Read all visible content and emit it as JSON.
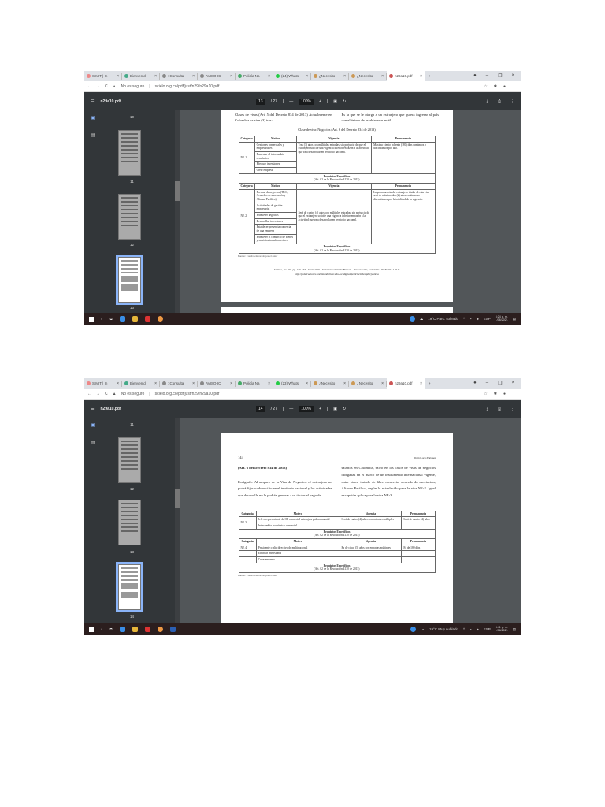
{
  "shot1": {
    "tabs": [
      "SIMIT | In",
      "Bienvenid",
      "::Consulta",
      "AVISO-IC",
      "Policía Na",
      "(24) Whats",
      "¿Necesito",
      "¿Necesito",
      "n29a10.pdf"
    ],
    "url": "scielo.org.co/pdf/just/n29/n29a10.pdf",
    "security": "No es seguro",
    "file": "n29a10.pdf",
    "page": "13",
    "total": "/ 27",
    "zoom": "100%",
    "thumbs": [
      "10",
      "11",
      "12",
      "13"
    ],
    "text_left": "Clases de visas (Art. 5 del Decreto 834 de 2013) Actualmente en Colombia existen (3) tres:",
    "text_right": "Es la que se le otorga a un extranjero que quiera ingresar al país con el ánimo de establecerse en él.",
    "table_title": "Clase de visa: Negocios (Art. 6 del Decreto 834 de 2013)",
    "headers": [
      "Categoría",
      "Motivo",
      "Vigencia",
      "Permanencia"
    ],
    "ne1": {
      "cat": "NE 1",
      "motivos": [
        "Gestiones comerciales y empresariales",
        "Fomentar el intercambio económico",
        "Efectuar inversiones",
        "Crear empresa"
      ],
      "vig": "Tres (3) años con múltiples entradas, sin perjuicio de que el extranjero solicite una vigencia inferior en razón a la actividad que va a desarrollar en territorio nacional.",
      "perm": "Máximo ciento ochenta (180) días continuos o discontinuos por año."
    },
    "req": "Requisitos Específicos",
    "req_ref": "(Art. 02 de la Resolución 4130 de 2015)",
    "ne2": {
      "cat": "NE 2",
      "motivos": [
        "Persona de negocios (TLC, Acuerdos de asociación y Alianza Pacífico)",
        "Actividades de gestión empresarial",
        "Promover negocios",
        "Desarrollar inversiones",
        "Establecer presencia comercial de una empresa",
        "Promover el comercio de bienes y servicios transfronterizos"
      ],
      "vig": "Será de cuatro (4) años con múltiples entradas, sin perjuicio de que el extranjero solicite una vigencia inferior en razón a la actividad que va a desarrollar en territorio nacional.",
      "perm": "La permanencia del extranjero titular de esta visa será de máximo dos (2) años continuos o discontinuos por la totalidad de la vigencia."
    },
    "source": "Fuente: Cuadro elaborado por el autor",
    "footer1": "Justicia, No. 29 - pp. 133-157 - Junio 2016 - Universidad Simón Bolívar - Barranquilla, Colombia - ISSN: 0124-7441",
    "footer2": "http://publicaciones.unisimonbolivar.edu.co/rdigital/justicia/index.php/justicia",
    "weather": "19°C Parc. soleado",
    "lang": "ESP",
    "time": "3:24 p. m.",
    "date": "1/06/2021"
  },
  "shot2": {
    "tabs": [
      "SIMIT | In",
      "Bienvenid",
      "::Consulta",
      "AVISO-IC",
      "Policía Na",
      "(23) Whats",
      "¿Necesito",
      "¿Necesito",
      "n29a10.pdf"
    ],
    "url": "scielo.org.co/pdf/just/n29/n29a10.pdf",
    "security": "No es seguro",
    "file": "n29a10.pdf",
    "page": "14",
    "total": "/ 27",
    "zoom": "100%",
    "thumbs": [
      "11",
      "12",
      "13",
      "14"
    ],
    "page_num": "144",
    "running_head": "David Lucas Enríquez",
    "text_left_head": "(Art. 6 del Decreto 834 de 2013)",
    "text_left": "Parágrafo: Al amparo de la Visa de Negocios el extranjero no podrá fijar su domicilio en el territorio nacional y las actividades que desarrolle no le podrán generar a su titular el pago de",
    "text_right": "salarios en Colombia, salvo en los casos de visas de negocios otorgadas en el marco de un instrumento internacional vigente, entre otros: tratado de libre comercio, acuerdo de asociación, Alianza Pacífico, según lo establecido para la visa NE-2. Igual excepción aplica para la visa NE-3.",
    "headers": [
      "Categoría",
      "Motivo",
      "Vigencia",
      "Permanencia"
    ],
    "ne3": {
      "cat": "NE 3",
      "motivos": [
        "Jefe o representante de OP comercial extranjera gubernamental",
        "Intercambio económico comercial"
      ],
      "vig": "Será de cuatro (4) años con entradas múltiples",
      "perm": "Será de cuatro (4) años"
    },
    "req": "Requisitos Específicos",
    "req_ref": "(Art. 02 de la Resolución 4130 de 2015)",
    "ne4": {
      "cat": "NE 4",
      "motivos": [
        "Presidente o alto directivo de multinacional",
        "Efectuar inversiones",
        "Crear empresa"
      ],
      "vig": "Es de cinco (5) años con entradas múltiples",
      "perm": "Es de 180 días"
    },
    "source": "Fuente: Cuadro elaborado por el autor",
    "weather": "19°C Muy nublado",
    "lang": "ESP",
    "time": "3:41 p. m.",
    "date": "1/06/2021"
  }
}
